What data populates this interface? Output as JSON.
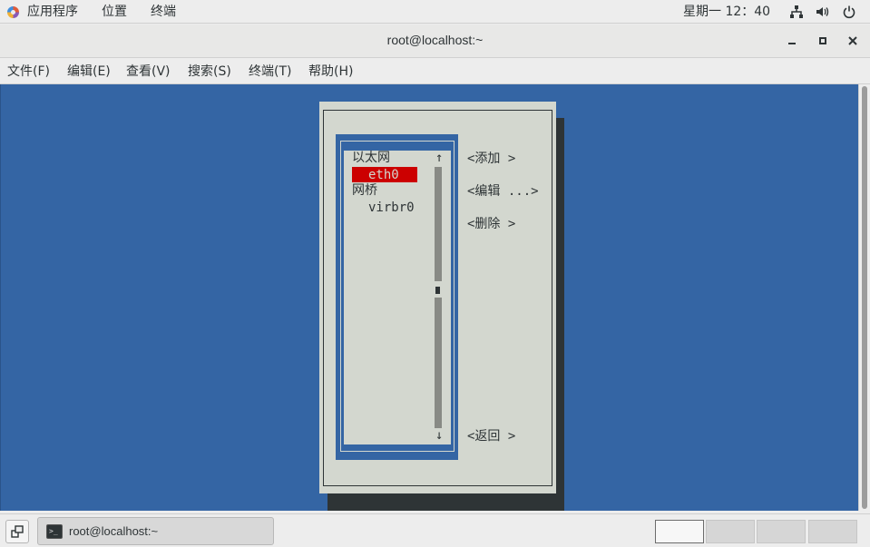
{
  "top_panel": {
    "applications": "应用程序",
    "places": "位置",
    "terminal": "终端",
    "clock": "星期一 12：40"
  },
  "window": {
    "title": "root@localhost:~"
  },
  "menubar": {
    "file": "文件(F)",
    "edit": "编辑(E)",
    "view": "查看(V)",
    "search": "搜索(S)",
    "terminal": "终端(T)",
    "help": "帮助(H)"
  },
  "dialog": {
    "list": {
      "group_ethernet": "以太网",
      "item_eth0": "eth0",
      "group_bridge": "网桥",
      "item_virbr0": "virbr0",
      "scroll_up": "↑",
      "scroll_down": "↓"
    },
    "buttons": {
      "add": "<添加 >",
      "edit": "<编辑 ...>",
      "delete": "<删除 >",
      "back": "<返回 >"
    }
  },
  "taskbar": {
    "task_label": "root@localhost:~",
    "task_icon_glyph": ">_"
  },
  "colors": {
    "terminal_bg": "#3465a4",
    "dialog_bg": "#d3d7cf",
    "selection": "#cc0000"
  }
}
